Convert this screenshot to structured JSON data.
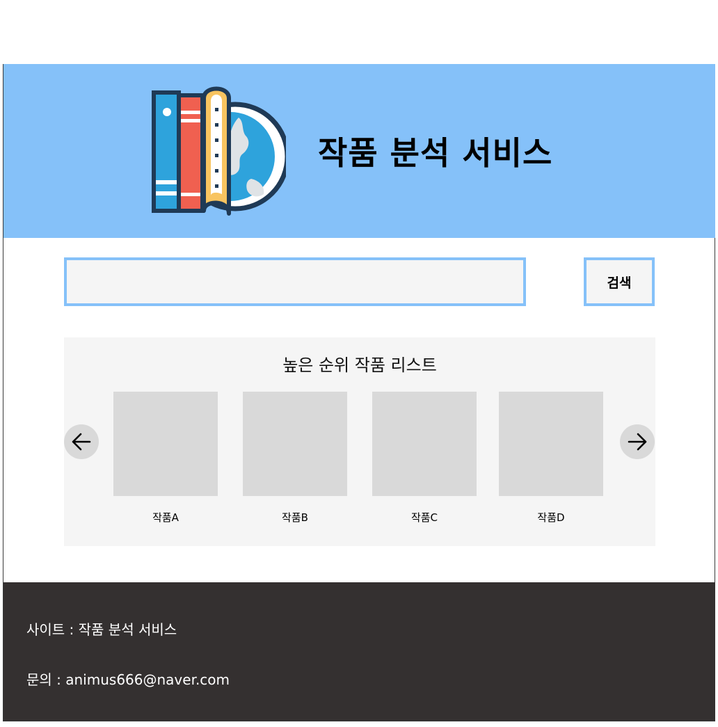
{
  "header": {
    "title": "작품 분석 서비스",
    "logo_icon": "books-globe-icon",
    "background_color": "#85c1f9"
  },
  "search": {
    "value": "",
    "placeholder": "",
    "button_label": "검색"
  },
  "ranking": {
    "title": "높은 순위 작품 리스트",
    "prev_icon": "arrow-left-icon",
    "next_icon": "arrow-right-icon",
    "items": [
      {
        "label": "작품A"
      },
      {
        "label": "작품B"
      },
      {
        "label": "작품C"
      },
      {
        "label": "작품D"
      }
    ]
  },
  "footer": {
    "site_line": "사이트 : 작품 분석 서비스",
    "contact_line": "문의 : animus666@naver.com",
    "background_color": "#343030"
  }
}
